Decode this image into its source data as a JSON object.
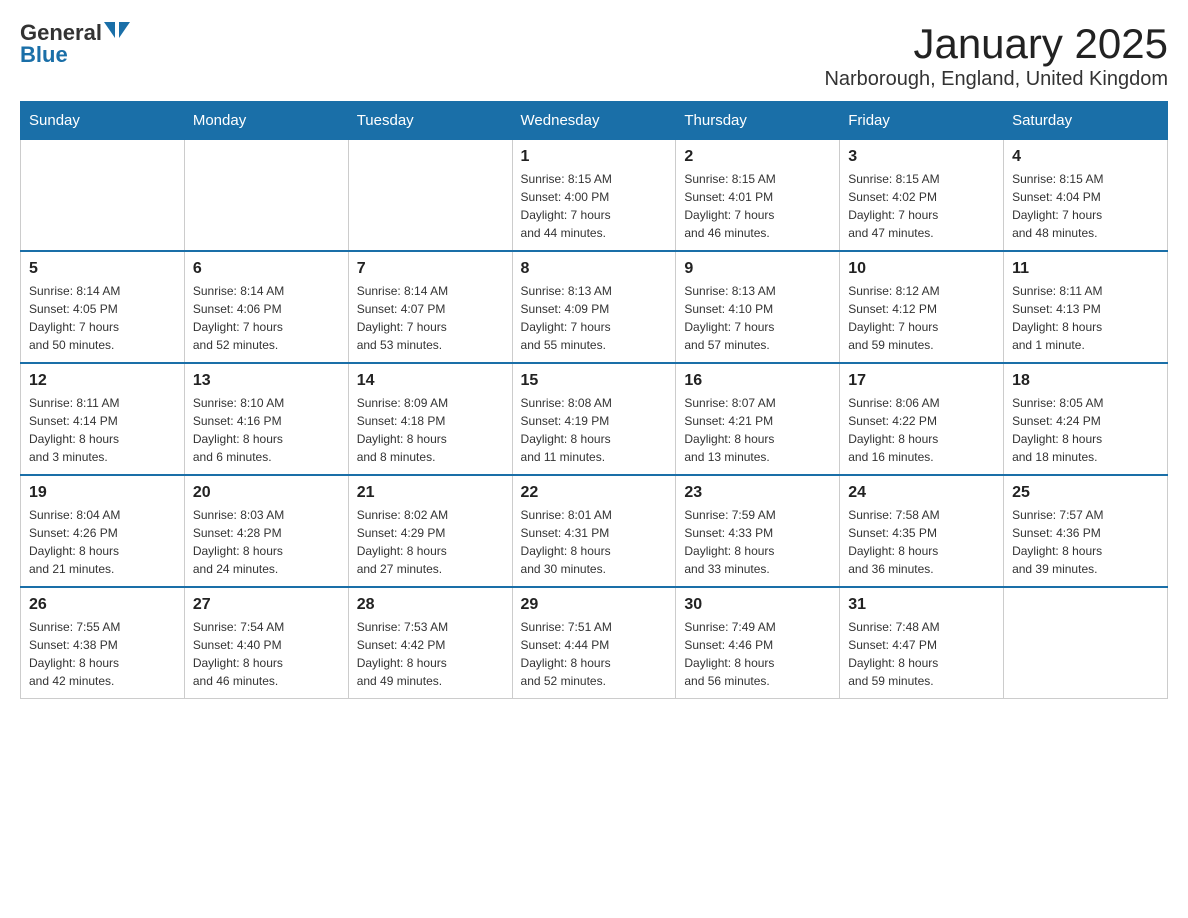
{
  "logo": {
    "general": "General",
    "blue": "Blue"
  },
  "title": "January 2025",
  "subtitle": "Narborough, England, United Kingdom",
  "days_of_week": [
    "Sunday",
    "Monday",
    "Tuesday",
    "Wednesday",
    "Thursday",
    "Friday",
    "Saturday"
  ],
  "weeks": [
    [
      {
        "day": "",
        "info": ""
      },
      {
        "day": "",
        "info": ""
      },
      {
        "day": "",
        "info": ""
      },
      {
        "day": "1",
        "info": "Sunrise: 8:15 AM\nSunset: 4:00 PM\nDaylight: 7 hours\nand 44 minutes."
      },
      {
        "day": "2",
        "info": "Sunrise: 8:15 AM\nSunset: 4:01 PM\nDaylight: 7 hours\nand 46 minutes."
      },
      {
        "day": "3",
        "info": "Sunrise: 8:15 AM\nSunset: 4:02 PM\nDaylight: 7 hours\nand 47 minutes."
      },
      {
        "day": "4",
        "info": "Sunrise: 8:15 AM\nSunset: 4:04 PM\nDaylight: 7 hours\nand 48 minutes."
      }
    ],
    [
      {
        "day": "5",
        "info": "Sunrise: 8:14 AM\nSunset: 4:05 PM\nDaylight: 7 hours\nand 50 minutes."
      },
      {
        "day": "6",
        "info": "Sunrise: 8:14 AM\nSunset: 4:06 PM\nDaylight: 7 hours\nand 52 minutes."
      },
      {
        "day": "7",
        "info": "Sunrise: 8:14 AM\nSunset: 4:07 PM\nDaylight: 7 hours\nand 53 minutes."
      },
      {
        "day": "8",
        "info": "Sunrise: 8:13 AM\nSunset: 4:09 PM\nDaylight: 7 hours\nand 55 minutes."
      },
      {
        "day": "9",
        "info": "Sunrise: 8:13 AM\nSunset: 4:10 PM\nDaylight: 7 hours\nand 57 minutes."
      },
      {
        "day": "10",
        "info": "Sunrise: 8:12 AM\nSunset: 4:12 PM\nDaylight: 7 hours\nand 59 minutes."
      },
      {
        "day": "11",
        "info": "Sunrise: 8:11 AM\nSunset: 4:13 PM\nDaylight: 8 hours\nand 1 minute."
      }
    ],
    [
      {
        "day": "12",
        "info": "Sunrise: 8:11 AM\nSunset: 4:14 PM\nDaylight: 8 hours\nand 3 minutes."
      },
      {
        "day": "13",
        "info": "Sunrise: 8:10 AM\nSunset: 4:16 PM\nDaylight: 8 hours\nand 6 minutes."
      },
      {
        "day": "14",
        "info": "Sunrise: 8:09 AM\nSunset: 4:18 PM\nDaylight: 8 hours\nand 8 minutes."
      },
      {
        "day": "15",
        "info": "Sunrise: 8:08 AM\nSunset: 4:19 PM\nDaylight: 8 hours\nand 11 minutes."
      },
      {
        "day": "16",
        "info": "Sunrise: 8:07 AM\nSunset: 4:21 PM\nDaylight: 8 hours\nand 13 minutes."
      },
      {
        "day": "17",
        "info": "Sunrise: 8:06 AM\nSunset: 4:22 PM\nDaylight: 8 hours\nand 16 minutes."
      },
      {
        "day": "18",
        "info": "Sunrise: 8:05 AM\nSunset: 4:24 PM\nDaylight: 8 hours\nand 18 minutes."
      }
    ],
    [
      {
        "day": "19",
        "info": "Sunrise: 8:04 AM\nSunset: 4:26 PM\nDaylight: 8 hours\nand 21 minutes."
      },
      {
        "day": "20",
        "info": "Sunrise: 8:03 AM\nSunset: 4:28 PM\nDaylight: 8 hours\nand 24 minutes."
      },
      {
        "day": "21",
        "info": "Sunrise: 8:02 AM\nSunset: 4:29 PM\nDaylight: 8 hours\nand 27 minutes."
      },
      {
        "day": "22",
        "info": "Sunrise: 8:01 AM\nSunset: 4:31 PM\nDaylight: 8 hours\nand 30 minutes."
      },
      {
        "day": "23",
        "info": "Sunrise: 7:59 AM\nSunset: 4:33 PM\nDaylight: 8 hours\nand 33 minutes."
      },
      {
        "day": "24",
        "info": "Sunrise: 7:58 AM\nSunset: 4:35 PM\nDaylight: 8 hours\nand 36 minutes."
      },
      {
        "day": "25",
        "info": "Sunrise: 7:57 AM\nSunset: 4:36 PM\nDaylight: 8 hours\nand 39 minutes."
      }
    ],
    [
      {
        "day": "26",
        "info": "Sunrise: 7:55 AM\nSunset: 4:38 PM\nDaylight: 8 hours\nand 42 minutes."
      },
      {
        "day": "27",
        "info": "Sunrise: 7:54 AM\nSunset: 4:40 PM\nDaylight: 8 hours\nand 46 minutes."
      },
      {
        "day": "28",
        "info": "Sunrise: 7:53 AM\nSunset: 4:42 PM\nDaylight: 8 hours\nand 49 minutes."
      },
      {
        "day": "29",
        "info": "Sunrise: 7:51 AM\nSunset: 4:44 PM\nDaylight: 8 hours\nand 52 minutes."
      },
      {
        "day": "30",
        "info": "Sunrise: 7:49 AM\nSunset: 4:46 PM\nDaylight: 8 hours\nand 56 minutes."
      },
      {
        "day": "31",
        "info": "Sunrise: 7:48 AM\nSunset: 4:47 PM\nDaylight: 8 hours\nand 59 minutes."
      },
      {
        "day": "",
        "info": ""
      }
    ]
  ]
}
